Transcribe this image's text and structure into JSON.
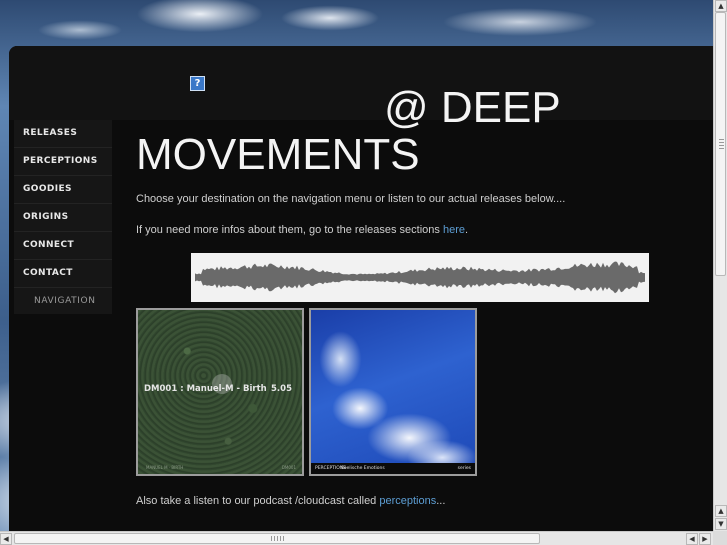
{
  "page": {
    "title_line1": "@ DEEP",
    "title_line2": "MOVEMENTS",
    "broken_image_glyph": "?"
  },
  "nav": {
    "items": [
      {
        "label": "RELEASES"
      },
      {
        "label": "PERCEPTIONS"
      },
      {
        "label": "GOODIES"
      },
      {
        "label": "ORIGINS"
      },
      {
        "label": "CONNECT"
      },
      {
        "label": "CONTACT"
      }
    ],
    "caption": "NAVIGATION"
  },
  "content": {
    "intro": "Choose your destination on the navigation menu or listen to our actual releases below....",
    "infos_prefix": "If you need more infos about them, go to the releases sections ",
    "infos_link": "here",
    "infos_suffix": ".",
    "podcast_prefix": "Also take a listen to our podcast /cloudcast called ",
    "podcast_link": "perceptions",
    "podcast_suffix": "..."
  },
  "releases": [
    {
      "track": "DM001 : Manuel-M - Birth",
      "duration": "5.05",
      "footer_left": "MANUEL M · BIRTH",
      "footer_right": "DM001"
    },
    {
      "footer_a": "PERCEPTIONS",
      "footer_b": "Seelische Emotions",
      "footer_c": "series"
    }
  ],
  "colors": {
    "panel": "#0c0c0c",
    "link": "#5d9ed4",
    "title": "#f4f4f4"
  },
  "icons": {
    "scroll_up": "▲",
    "scroll_down": "▼",
    "scroll_left": "◀",
    "scroll_right": "▶"
  }
}
